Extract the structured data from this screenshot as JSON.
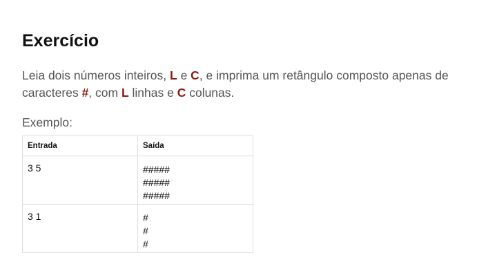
{
  "page": {
    "title": "Exercício",
    "statement": {
      "t1": "Leia dois números inteiros, ",
      "L": "L",
      "t2": " e ",
      "C": "C",
      "t3": ", e imprima um retângulo composto apenas de caracteres ",
      "hash": "#",
      "t4": ", com ",
      "L2": "L",
      "t5": " linhas e ",
      "C2": "C",
      "t6": " colunas."
    },
    "example_label": "Exemplo:"
  },
  "table": {
    "headers": [
      "Entrada",
      "Saída"
    ],
    "rows": [
      {
        "input": "3 5",
        "output": [
          "#####",
          "#####",
          "#####"
        ]
      },
      {
        "input": "3 1",
        "output": [
          "#",
          "#",
          "#"
        ]
      }
    ]
  },
  "colors": {
    "highlight": "#8b1a10",
    "text": "#555555",
    "heading": "#111111"
  }
}
